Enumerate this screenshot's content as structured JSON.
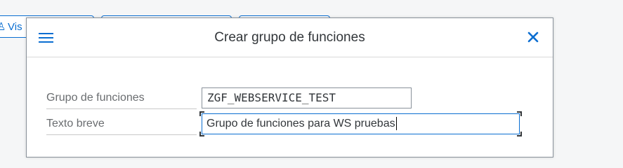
{
  "toolbar": {
    "first_button_label": "Vis",
    "first_button_icon": "person-icon"
  },
  "dialog": {
    "title": "Crear grupo de funciones",
    "menu_icon": "hamburger-menu-icon",
    "close_icon": "close-icon"
  },
  "form": {
    "function_group": {
      "label": "Grupo de funciones",
      "value": "ZGF_WEBSERVICE_TEST"
    },
    "short_text": {
      "label": "Texto breve",
      "value": "Grupo de funciones para WS pruebas"
    }
  },
  "colors": {
    "accent": "#0a6ed1",
    "text": "#32363a",
    "label": "#6a6d70"
  }
}
